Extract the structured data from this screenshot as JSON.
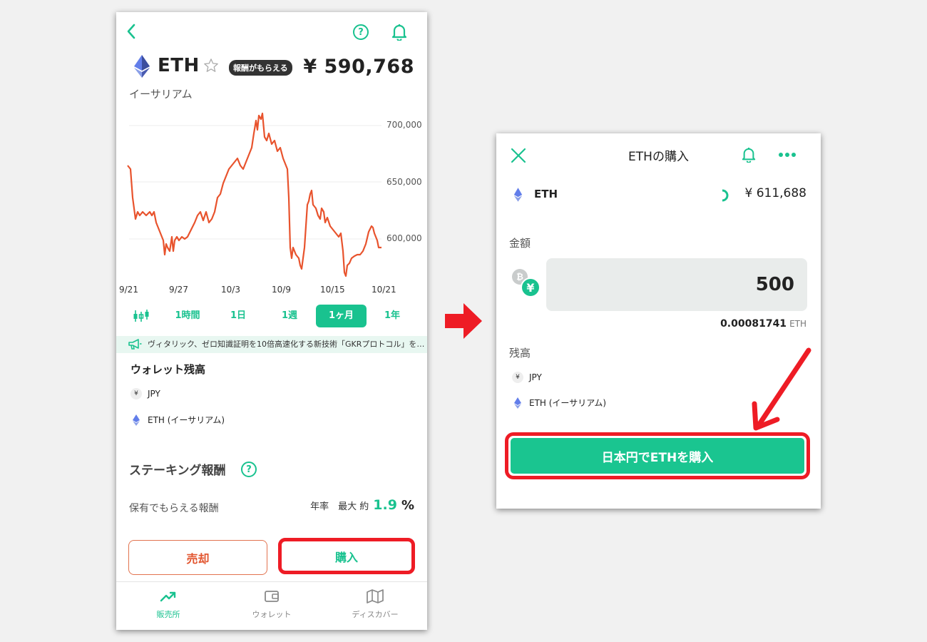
{
  "left": {
    "coin_symbol": "ETH",
    "reward_badge": "報酬がもらえる",
    "price": "¥ 590,768",
    "coin_name": "イーサリアム",
    "y_ticks": [
      "700,000",
      "650,000",
      "600,000"
    ],
    "x_ticks": [
      "9/21",
      "9/27",
      "10/3",
      "10/9",
      "10/15",
      "10/21"
    ],
    "ranges": [
      "1時間",
      "1日",
      "1週",
      "1ヶ月",
      "1年"
    ],
    "active_range": "1ヶ月",
    "news": "ヴィタリック、ゼロ知識証明を10倍高速化する新技術「GKRプロトコル」を…",
    "wallet_title": "ウォレット残高",
    "balances": [
      {
        "symbol": "¥",
        "label": "JPY"
      },
      {
        "symbol": "eth",
        "label": "ETH (イーサリアム)"
      }
    ],
    "staking_title": "ステーキング報酬",
    "hold_label": "保有でもらえる報酬",
    "rate_prefix": "年率　最大 約",
    "rate_value": "1.9",
    "rate_unit": "%",
    "sell_label": "売却",
    "buy_label": "購入",
    "tabs": [
      "販売所",
      "ウォレット",
      "ディスカバー"
    ],
    "colors": {
      "accent": "#19c28f",
      "line": "#e8532d",
      "highlight": "#ee1c25"
    }
  },
  "right": {
    "title": "ETHの購入",
    "coin_symbol": "ETH",
    "price": "¥ 611,688",
    "amount_label": "金額",
    "amount_value": "500",
    "conversion_value": "0.00081741",
    "conversion_unit": "ETH",
    "balance_title": "残高",
    "balances": [
      {
        "symbol": "¥",
        "label": "JPY"
      },
      {
        "symbol": "eth",
        "label": "ETH (イーサリアム)"
      }
    ],
    "cta_label": "日本円でETHを購入"
  }
}
